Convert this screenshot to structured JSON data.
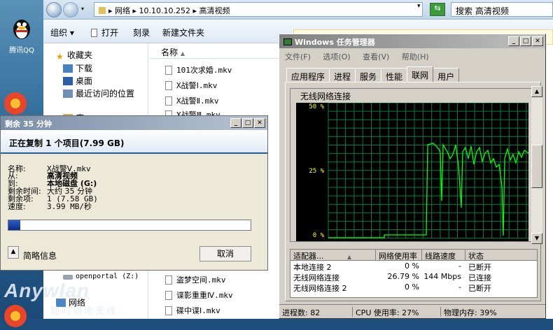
{
  "desktop": {
    "qq_label": "腾讯QQ"
  },
  "explorer": {
    "address": "▸ 网络 ▸ 10.10.10.252 ▸ 高清视频",
    "search_placeholder": "搜索 高清视频",
    "toolbar": {
      "organize": "组织 ▾",
      "open": "打开",
      "burn": "刻录",
      "new_folder": "新建文件夹"
    },
    "nav": {
      "favorites": "收藏夹",
      "downloads": "下载",
      "desktop": "桌面",
      "recent": "最近访问的位置",
      "lib_partial": "库",
      "openportal": "openportal (Z:)",
      "network": "网络"
    },
    "column_name": "名称",
    "files": [
      "101次求婚.mkv",
      "X战警Ⅰ.mkv",
      "X战警Ⅱ.mkv",
      "X战警Ⅲ.mkv",
      "盗梦空间.mkv",
      "谍影重重Ⅳ.mkv",
      "碟中谍Ⅰ.mkv"
    ]
  },
  "copy_dialog": {
    "title": "剩余 35 分钟",
    "heading": "正在复制 1 个项目(7.99 GB)",
    "name_label": "名称:",
    "name_value": "X战警Ⅴ.mkv",
    "from_label": "从:",
    "from_value": "高清视频",
    "to_label": "到:",
    "to_value": "本地磁盘 (G:)",
    "remaining_time_label": "剩余时间:",
    "remaining_time_value": "大约 35 分钟",
    "remaining_items_label": "剩余项:",
    "remaining_items_value": "1 (7.58 GB)",
    "speed_label": "速度:",
    "speed_value": "3.99 MB/秒",
    "progress": 0.05,
    "details_label": "简略信息",
    "cancel_label": "取消"
  },
  "task_manager": {
    "title": "Windows 任务管理器",
    "menu": [
      "文件(F)",
      "选项(O)",
      "查看(V)",
      "帮助(H)"
    ],
    "tabs": [
      "应用程序",
      "进程",
      "服务",
      "性能",
      "联网",
      "用户"
    ],
    "active_tab": "联网",
    "graph_title": "无线网络连接",
    "y_labels": [
      "50 %",
      "25 %",
      "0 %"
    ],
    "columns": [
      "适配器...",
      "网络使用率",
      "线路速度",
      "状态"
    ],
    "rows": [
      {
        "adapter": "本地连接 2",
        "usage": "0 %",
        "speed": "-",
        "status": "已断开"
      },
      {
        "adapter": "无线网络连接",
        "usage": "26.79 %",
        "speed": "144 Mbps",
        "status": "已连接"
      },
      {
        "adapter": "无线网络连接 2",
        "usage": "0 %",
        "speed": "-",
        "status": "已断开"
      }
    ],
    "status": {
      "processes": "进程数: 82",
      "cpu": "CPU 使用率: 27%",
      "memory": "物理内存: 39%"
    },
    "colors": {
      "graph_line": "#00ff00",
      "grid": "#008040"
    }
  },
  "watermark": {
    "brand": "Anywlan",
    "slogan": "随时随地无线"
  }
}
